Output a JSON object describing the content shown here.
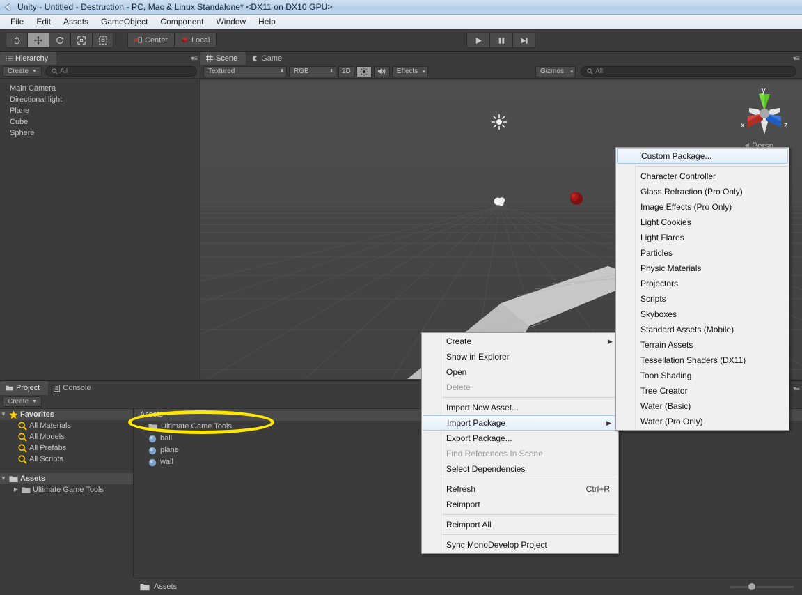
{
  "window": {
    "title": "Unity - Untitled - Destruction - PC, Mac & Linux Standalone* <DX11 on DX10 GPU>",
    "icon": "unity-logo-icon"
  },
  "menubar": {
    "items": [
      {
        "label": "File"
      },
      {
        "label": "Edit"
      },
      {
        "label": "Assets"
      },
      {
        "label": "GameObject"
      },
      {
        "label": "Component"
      },
      {
        "label": "Window"
      },
      {
        "label": "Help"
      }
    ]
  },
  "toolbar": {
    "transform_tools": [
      {
        "name": "hand-tool",
        "glyph": "hand-icon",
        "active": false
      },
      {
        "name": "move-tool",
        "glyph": "move-icon",
        "active": true
      },
      {
        "name": "rotate-tool",
        "glyph": "rotate-icon",
        "active": false
      },
      {
        "name": "scale-tool",
        "glyph": "scale-icon",
        "active": false
      },
      {
        "name": "rect-tool",
        "glyph": "rect-icon",
        "active": false
      }
    ],
    "pivot_label": "Center",
    "space_label": "Local",
    "play_buttons": [
      {
        "name": "play-button",
        "glyph": "play-icon"
      },
      {
        "name": "pause-button",
        "glyph": "pause-icon"
      },
      {
        "name": "step-button",
        "glyph": "step-icon"
      }
    ]
  },
  "hierarchy": {
    "tab_label": "Hierarchy",
    "create_label": "Create",
    "search_placeholder": "All",
    "items": [
      {
        "label": "Main Camera"
      },
      {
        "label": "Directional light"
      },
      {
        "label": "Plane"
      },
      {
        "label": "Cube"
      },
      {
        "label": "Sphere"
      }
    ]
  },
  "sceneview": {
    "tabs": [
      {
        "label": "Scene",
        "selected": true
      },
      {
        "label": "Game",
        "selected": false
      }
    ],
    "draw_mode": "Textured",
    "color_mode": "RGB",
    "toggle_2d": "2D",
    "lighting_icon": "sun-icon",
    "audio_icon": "audio-icon",
    "effects_label": "Effects",
    "gizmos_label": "Gizmos",
    "search_placeholder": "All",
    "gizmo": {
      "x_label": "x",
      "y_label": "y",
      "z_label": "z",
      "projection_label": "Persp",
      "x_color": "#c0392b",
      "y_color": "#5cc12a",
      "z_color": "#2d6fd8"
    },
    "objects": [
      {
        "name": "directional-light-gizmo",
        "type": "light"
      },
      {
        "name": "main-camera-gizmo",
        "type": "camera"
      },
      {
        "name": "sphere-object",
        "color": "#8b1414"
      },
      {
        "name": "cube-wall-object",
        "color": "#070707"
      },
      {
        "name": "plane-object",
        "color": "#c8c8c8"
      }
    ]
  },
  "project": {
    "tabs": [
      {
        "label": "Project",
        "selected": true
      },
      {
        "label": "Console",
        "selected": false
      }
    ],
    "create_label": "Create",
    "favorites": {
      "label": "Favorites",
      "items": [
        {
          "label": "All Materials",
          "icon": "search-icon"
        },
        {
          "label": "All Models",
          "icon": "search-icon"
        },
        {
          "label": "All Prefabs",
          "icon": "search-icon"
        },
        {
          "label": "All Scripts",
          "icon": "search-icon"
        }
      ]
    },
    "assets_tree": {
      "label": "Assets",
      "items": [
        {
          "label": "Ultimate Game Tools",
          "icon": "folder-icon"
        }
      ]
    },
    "assets_list": {
      "header": "Assets",
      "items": [
        {
          "label": "Ultimate Game Tools",
          "icon": "folder-icon",
          "highlighted": true
        },
        {
          "label": "ball",
          "icon": "material-icon"
        },
        {
          "label": "plane",
          "icon": "material-icon"
        },
        {
          "label": "wall",
          "icon": "material-icon"
        }
      ]
    },
    "statusbar": {
      "path": "Assets",
      "icon": "folder-icon"
    }
  },
  "context_menu_asset": {
    "items": [
      {
        "label": "Create",
        "submenu": true,
        "disabled": false,
        "highlighted": false
      },
      {
        "label": "Show in Explorer",
        "submenu": false,
        "disabled": false,
        "highlighted": false
      },
      {
        "label": "Open",
        "submenu": false,
        "disabled": false,
        "highlighted": false
      },
      {
        "label": "Delete",
        "submenu": false,
        "disabled": true,
        "highlighted": false
      },
      {
        "separator": true
      },
      {
        "label": "Import New Asset...",
        "submenu": false,
        "disabled": false,
        "highlighted": false
      },
      {
        "label": "Import Package",
        "submenu": true,
        "disabled": false,
        "highlighted": true
      },
      {
        "label": "Export Package...",
        "submenu": false,
        "disabled": false,
        "highlighted": false
      },
      {
        "label": "Find References In Scene",
        "submenu": false,
        "disabled": true,
        "highlighted": false
      },
      {
        "label": "Select Dependencies",
        "submenu": false,
        "disabled": false,
        "highlighted": false
      },
      {
        "separator": true
      },
      {
        "label": "Refresh",
        "shortcut": "Ctrl+R",
        "submenu": false,
        "disabled": false,
        "highlighted": false
      },
      {
        "label": "Reimport",
        "submenu": false,
        "disabled": false,
        "highlighted": false
      },
      {
        "separator": true
      },
      {
        "label": "Reimport All",
        "submenu": false,
        "disabled": false,
        "highlighted": false
      },
      {
        "separator": true
      },
      {
        "label": "Sync MonoDevelop Project",
        "submenu": false,
        "disabled": false,
        "highlighted": false
      }
    ]
  },
  "context_menu_import_package": {
    "items": [
      {
        "label": "Custom Package...",
        "highlighted": true
      },
      {
        "separator": true
      },
      {
        "label": "Character Controller",
        "highlighted": false
      },
      {
        "label": "Glass Refraction (Pro Only)",
        "highlighted": false
      },
      {
        "label": "Image Effects (Pro Only)",
        "highlighted": false
      },
      {
        "label": "Light Cookies",
        "highlighted": false
      },
      {
        "label": "Light Flares",
        "highlighted": false
      },
      {
        "label": "Particles",
        "highlighted": false
      },
      {
        "label": "Physic Materials",
        "highlighted": false
      },
      {
        "label": "Projectors",
        "highlighted": false
      },
      {
        "label": "Scripts",
        "highlighted": false
      },
      {
        "label": "Skyboxes",
        "highlighted": false
      },
      {
        "label": "Standard Assets (Mobile)",
        "highlighted": false
      },
      {
        "label": "Terrain Assets",
        "highlighted": false
      },
      {
        "label": "Tessellation Shaders (DX11)",
        "highlighted": false
      },
      {
        "label": "Toon Shading",
        "highlighted": false
      },
      {
        "label": "Tree Creator",
        "highlighted": false
      },
      {
        "label": "Water (Basic)",
        "highlighted": false
      },
      {
        "label": "Water (Pro Only)",
        "highlighted": false
      }
    ]
  },
  "annotation": {
    "shape": "ellipse",
    "color": "#ffe800",
    "target": "Ultimate Game Tools"
  }
}
